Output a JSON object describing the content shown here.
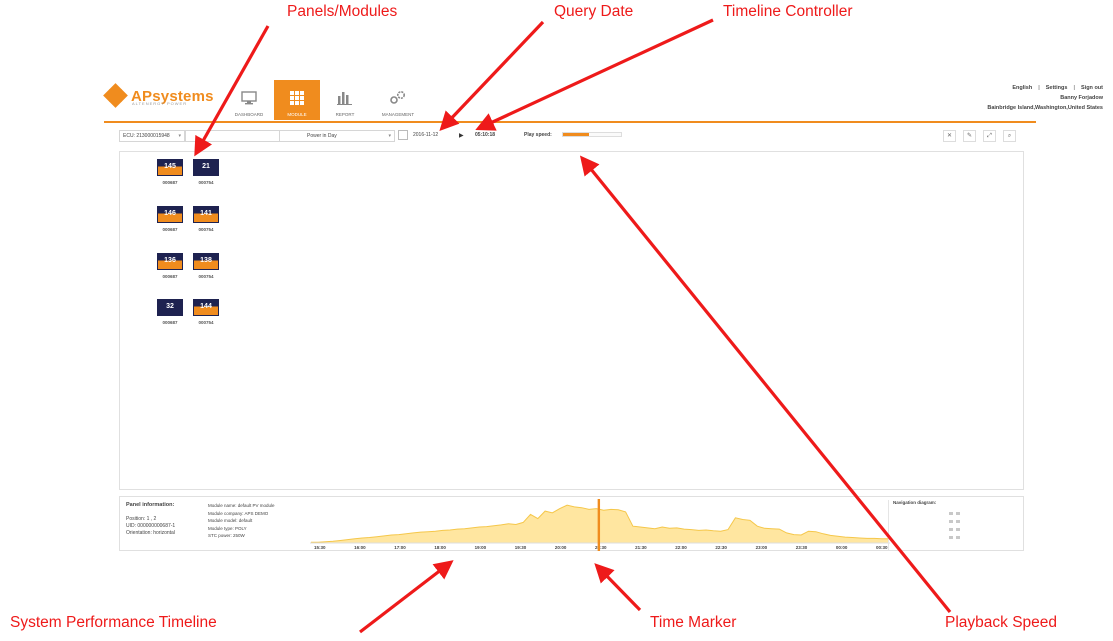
{
  "header": {
    "logo_text": "APsystems",
    "logo_sub": "ALTENERGY POWER",
    "nav": [
      {
        "label": "DASHBOARD",
        "icon": "monitor-icon"
      },
      {
        "label": "MODULE",
        "icon": "grid-icon",
        "active": true
      },
      {
        "label": "REPORT",
        "icon": "bar-chart-icon"
      },
      {
        "label": "MANAGEMENT",
        "icon": "gears-icon"
      }
    ],
    "links": {
      "language": "English",
      "settings": "Settings",
      "signout": "Sign out"
    },
    "user_name": "Banny Forjadow",
    "location": "Bainbridge Island,Washington,United States"
  },
  "toolbar": {
    "ecu": "ECU: 213000015948",
    "blank_select": "",
    "metric": "Power in Day",
    "date": "2016-11-12",
    "time": "05:10:18",
    "play_speed_label": "Play speed:",
    "play_speed_fraction": 0.45
  },
  "modules": [
    {
      "value": "145",
      "label": "000687",
      "style": "orange"
    },
    {
      "value": "21",
      "label": "000754",
      "style": "dark"
    },
    {
      "value": "146",
      "label": "000687",
      "style": "orange"
    },
    {
      "value": "141",
      "label": "000754",
      "style": "orange"
    },
    {
      "value": "136",
      "label": "000687",
      "style": "orange"
    },
    {
      "value": "138",
      "label": "000754",
      "style": "orange"
    },
    {
      "value": "32",
      "label": "000687",
      "style": "dark"
    },
    {
      "value": "144",
      "label": "000754",
      "style": "orange"
    }
  ],
  "panel_info": {
    "title": "Panel information:",
    "position": "Position:  1 , 2",
    "uid": "UID:  000000000687-1",
    "orientation": "Orientation:  horizontal"
  },
  "module_info": {
    "name": "Module name:  default PV module",
    "company": "Module company:  APS DEMO",
    "model": "Module model:  default",
    "type": "Module type:  POLY",
    "stc": "STC power:  250W"
  },
  "timeline": {
    "ticks": [
      "15:30",
      "16:00",
      "17:00",
      "18:00",
      "19:00",
      "19:30",
      "20:00",
      "20:30",
      "21:30",
      "22:00",
      "22:30",
      "23:00",
      "23:30",
      "00:00",
      "00:30"
    ],
    "values": [
      2,
      2,
      3,
      4,
      6,
      8,
      10,
      12,
      13,
      15,
      17,
      19,
      20,
      22,
      24,
      26,
      27,
      28,
      30,
      31,
      33,
      34,
      36,
      38,
      39,
      41,
      43,
      46,
      44,
      49,
      68,
      58,
      76,
      72,
      82,
      90,
      86,
      84,
      80,
      82,
      78,
      80,
      79,
      74,
      40,
      38,
      36,
      34,
      38,
      35,
      36,
      33,
      32,
      30,
      31,
      29,
      28,
      32,
      60,
      56,
      54,
      40,
      35,
      34,
      33,
      24,
      20,
      19,
      28,
      27,
      22,
      18,
      16,
      14,
      13,
      12,
      11,
      11,
      10,
      10
    ],
    "marker_fraction": 0.498,
    "colors": {
      "fill": "#ffe6a0",
      "stroke": "#f5c74a",
      "marker": "#f08c1e"
    }
  },
  "nav_diagram": {
    "title": "Navigation diagram:"
  },
  "annotations": {
    "panels": "Panels/Modules",
    "query_date": "Query Date",
    "timeline_controller": "Timeline Controller",
    "perf_timeline": "System Performance Timeline",
    "time_marker": "Time Marker",
    "playback_speed": "Playback Speed"
  },
  "colors": {
    "accent": "#f08c1e",
    "module_dark": "#1e2250",
    "annotation": "#ee1a1a"
  }
}
